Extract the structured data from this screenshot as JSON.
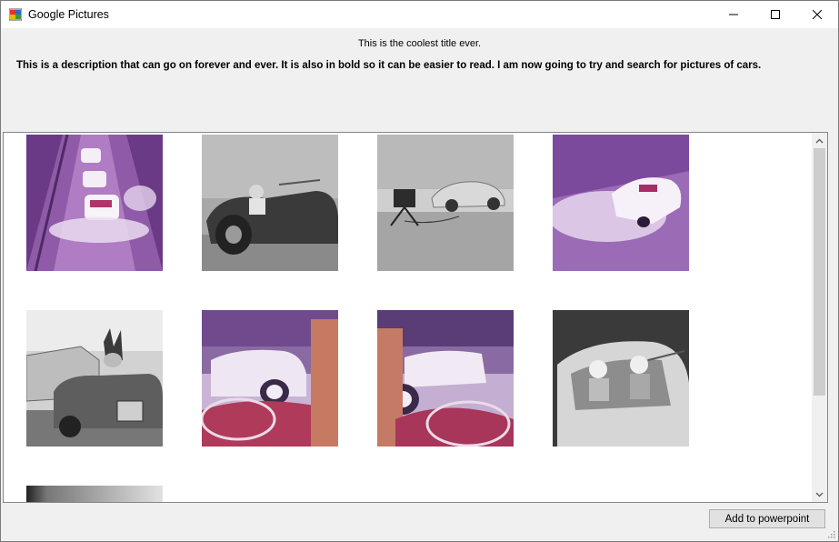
{
  "window": {
    "title": "Google Pictures"
  },
  "header": {
    "title": "This is the coolest title ever.",
    "description": "This is a description that can go on forever and ever. It is also in bold so it can be easier to read. I am now going to try and search for pictures of cars."
  },
  "gallery": {
    "images": [
      {
        "subject": "purple-tinted white convertibles splashing through water on a track"
      },
      {
        "subject": "black and white photo of a woman driving a dark convertible"
      },
      {
        "subject": "black and white photo of a sports car on a street with a tripod"
      },
      {
        "subject": "purple-tinted white corvette splashing through water"
      },
      {
        "subject": "black and white photo of a dog in a convertible in traffic"
      },
      {
        "subject": "purple-tinted white convertible seen from a red car interior"
      },
      {
        "subject": "purple-tinted white convertible beside a driver in a red car"
      },
      {
        "subject": "black and white photo of a couple in an open convertible"
      },
      {
        "subject": "partially visible blurred image"
      }
    ]
  },
  "footer": {
    "button_label": "Add to powerpoint"
  },
  "colors": {
    "window_bg": "#f0f0f0",
    "gallery_bg": "#ffffff",
    "purple_tint": "#8a4fa6"
  }
}
